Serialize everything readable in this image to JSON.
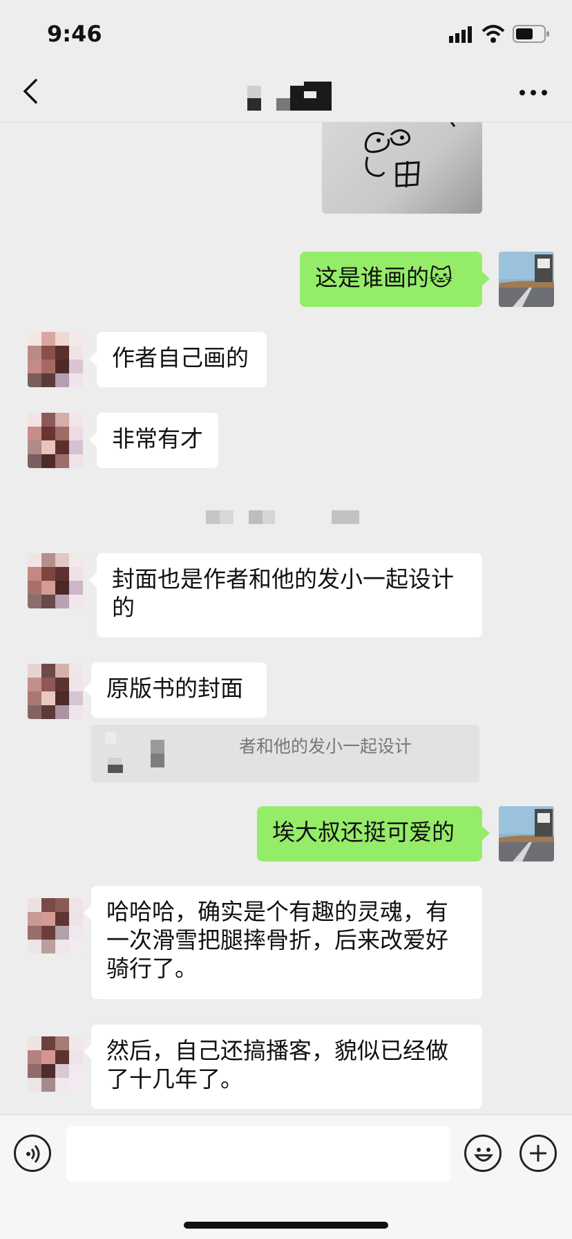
{
  "status_bar": {
    "time": "9:46"
  },
  "nav": {
    "back_icon": "chevron-left-icon",
    "more_icon": "ellipsis-icon"
  },
  "colors": {
    "background": "#ededed",
    "incoming_bubble": "#ffffff",
    "outgoing_bubble": "#95ec69",
    "input_bar": "#f6f6f6"
  },
  "messages": [
    {
      "side": "out",
      "type": "image"
    },
    {
      "side": "out",
      "text": "这是谁画的",
      "emoji": "🐱"
    },
    {
      "side": "in",
      "text": "作者自己画的"
    },
    {
      "side": "in",
      "text": "非常有才"
    },
    {
      "side": "in",
      "text": "封面也是作者和他的发小一起设计的"
    },
    {
      "side": "in",
      "text": "原版书的封面",
      "quote_text": "者和他的发小一起设计"
    },
    {
      "side": "out",
      "text": "埃大叔还挺可爱的"
    },
    {
      "side": "in",
      "text": "哈哈哈，确实是个有趣的灵魂，有一次滑雪把腿摔骨折，后来改爱好骑行了。"
    },
    {
      "side": "in",
      "text": "然后，自己还搞播客，貌似已经做了十几年了。"
    }
  ],
  "input_bar": {
    "voice_icon": "voice-icon",
    "emoji_icon": "emoji-icon",
    "plus_icon": "plus-icon"
  }
}
